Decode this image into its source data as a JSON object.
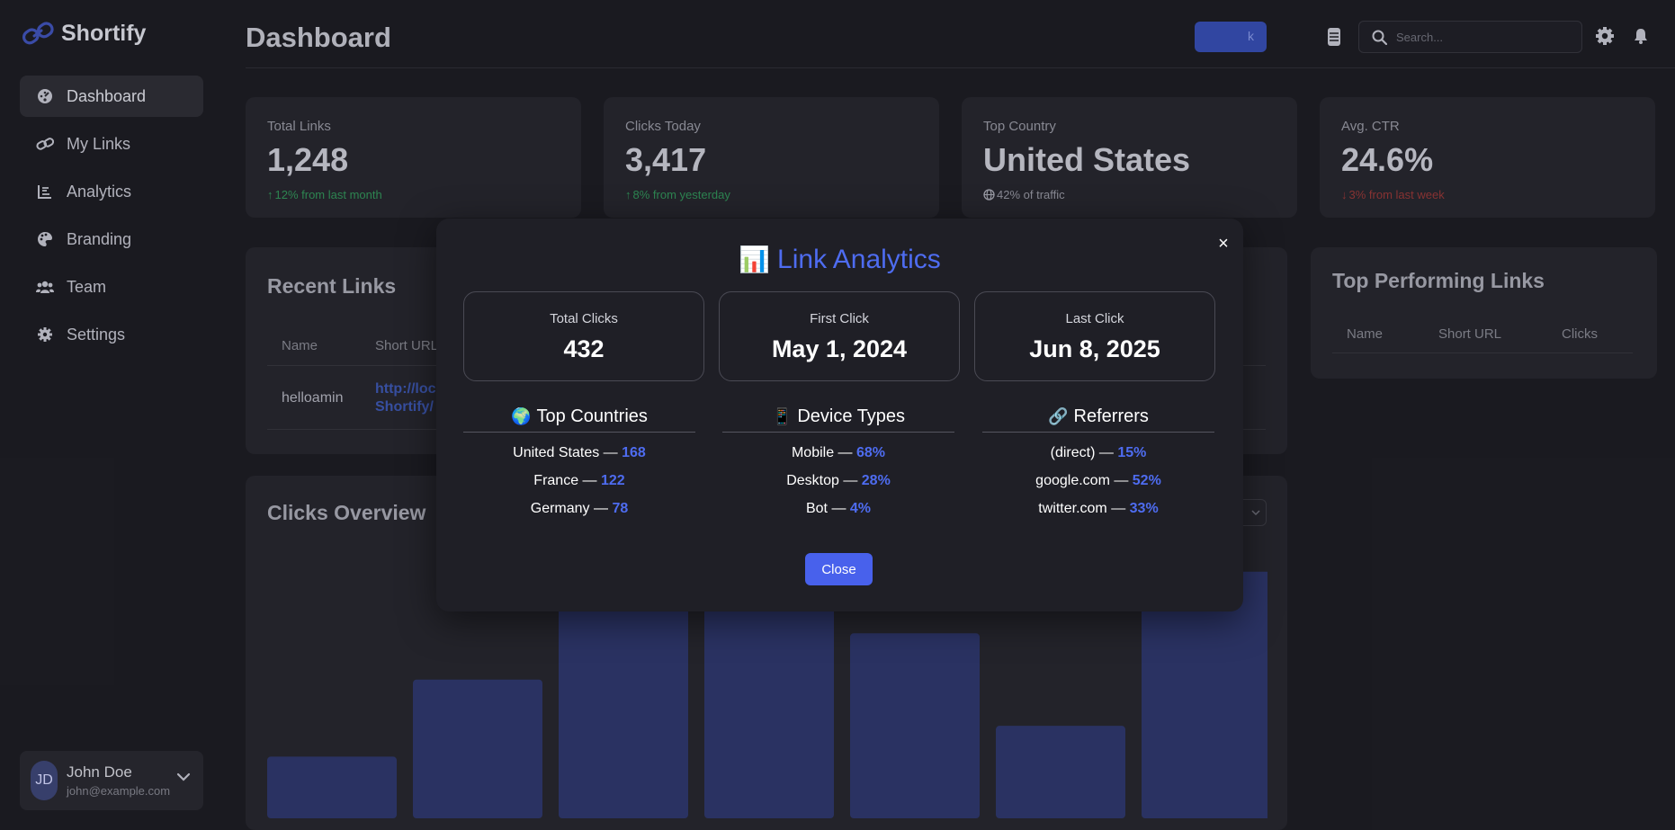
{
  "app": {
    "name": "Shortify"
  },
  "sidebar": {
    "items": [
      {
        "label": "Dashboard",
        "icon": "palette-gauge-icon",
        "active": true
      },
      {
        "label": "My Links",
        "icon": "link-icon"
      },
      {
        "label": "Analytics",
        "icon": "chart-line-icon"
      },
      {
        "label": "Branding",
        "icon": "palette-icon"
      },
      {
        "label": "Team",
        "icon": "users-icon"
      },
      {
        "label": "Settings",
        "icon": "gear-icon"
      }
    ],
    "user": {
      "initials": "JD",
      "name": "John Doe",
      "email": "john@example.com"
    }
  },
  "header": {
    "title": "Dashboard",
    "search": {
      "placeholder": "Search...",
      "value": ""
    }
  },
  "stats": [
    {
      "label": "Total Links",
      "value": "1,248",
      "sub": "12% from last month",
      "trend": "up"
    },
    {
      "label": "Clicks Today",
      "value": "3,417",
      "sub": "8% from yesterday",
      "trend": "up"
    },
    {
      "label": "Top Country",
      "value": "United States",
      "sub": "42% of traffic",
      "trend": "neutral"
    },
    {
      "label": "Avg. CTR",
      "value": "24.6%",
      "sub": "3% from last week",
      "trend": "down"
    }
  ],
  "recent_links": {
    "title": "Recent Links",
    "columns": [
      "Name",
      "Short URL"
    ],
    "rows": [
      {
        "name": "helloamin",
        "short_url_line1": "http://loc",
        "short_url_line2": "Shortify/"
      }
    ],
    "create_button_label": "k"
  },
  "top_links": {
    "title": "Top Performing Links",
    "columns": [
      "Name",
      "Short URL",
      "Clicks"
    ]
  },
  "clicks_overview": {
    "title": "Clicks Overview"
  },
  "chart_data": {
    "type": "bar",
    "categories": [
      "",
      "",
      "",
      "",
      "",
      "",
      ""
    ],
    "values": [
      16,
      36,
      56,
      70,
      48,
      24,
      64
    ],
    "ylim": [
      0,
      70
    ],
    "color": "#2c3566"
  },
  "modal": {
    "title_emoji": "📊",
    "title": "Link Analytics",
    "close_symbol": "×",
    "metrics": [
      {
        "label": "Total Clicks",
        "value": "432"
      },
      {
        "label": "First Click",
        "value": "May 1, 2024"
      },
      {
        "label": "Last Click",
        "value": "Jun 8, 2025"
      }
    ],
    "breakdowns": [
      {
        "emoji": "🌍",
        "title": "Top Countries",
        "items": [
          {
            "name": "United States",
            "value": "168"
          },
          {
            "name": "France",
            "value": "122"
          },
          {
            "name": "Germany",
            "value": "78"
          }
        ]
      },
      {
        "emoji": "📱",
        "title": "Device Types",
        "items": [
          {
            "name": "Mobile",
            "value": "68%"
          },
          {
            "name": "Desktop",
            "value": "28%"
          },
          {
            "name": "Bot",
            "value": "4%"
          }
        ]
      },
      {
        "emoji": "🔗",
        "title": "Referrers",
        "items": [
          {
            "name": "(direct)",
            "value": "15%"
          },
          {
            "name": "google.com",
            "value": "52%"
          },
          {
            "name": "twitter.com",
            "value": "33%"
          }
        ]
      }
    ],
    "close_button_label": "Close"
  },
  "colors": {
    "accent": "#4e6cf0",
    "up": "#2f8b55",
    "down": "#8d3535",
    "background": "#1c1c22",
    "card": "#25252c"
  }
}
